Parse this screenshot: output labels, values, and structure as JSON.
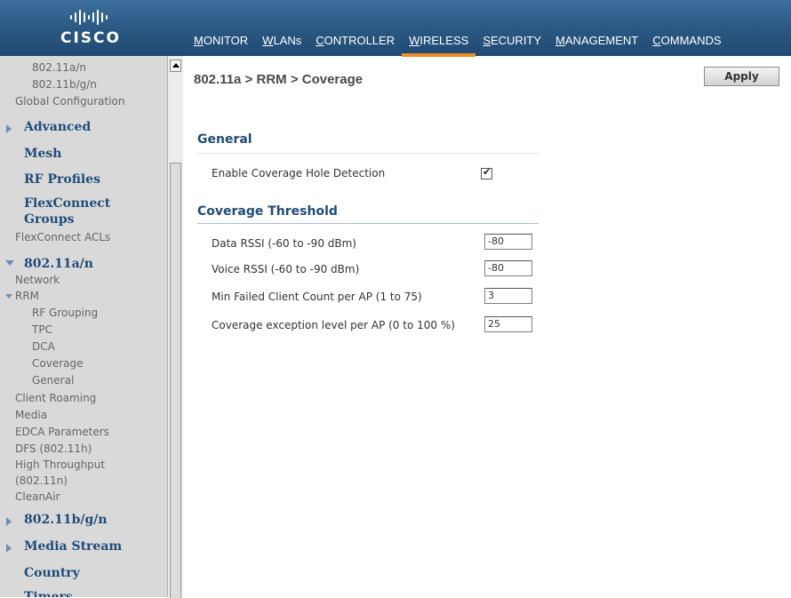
{
  "header": {
    "brand": "CISCO",
    "nav": [
      {
        "first": "M",
        "rest": "ONITOR"
      },
      {
        "first": "W",
        "rest": "LANs"
      },
      {
        "first": "C",
        "rest": "ONTROLLER"
      },
      {
        "first": "W",
        "rest": "IRELESS"
      },
      {
        "first": "S",
        "rest": "ECURITY"
      },
      {
        "first": "M",
        "rest": "ANAGEMENT"
      },
      {
        "first": "C",
        "rest": "OMMANDS"
      }
    ],
    "active_index": 3,
    "active_color": "#f28d26"
  },
  "sidebar": {
    "top": {
      "a": "802.11a/n",
      "bg": "802.11b/g/n",
      "global": "Global Configuration"
    },
    "advanced": "Advanced",
    "mesh": "Mesh",
    "rf_profiles": "RF Profiles",
    "flexconnect_groups_1": "FlexConnect",
    "flexconnect_groups_2": "Groups",
    "flexconnect_acls": "FlexConnect ACLs",
    "radio_a": "802.11a/n",
    "network": "Network",
    "rrm": "RRM",
    "rrm_items": [
      "RF Grouping",
      "TPC",
      "DCA",
      "Coverage",
      "General"
    ],
    "client_roaming": "Client Roaming",
    "media": "Media",
    "edca": "EDCA Parameters",
    "dfs": "DFS (802.11h)",
    "ht_1": "High Throughput",
    "ht_2": "(802.11n)",
    "cleanair": "CleanAir",
    "radio_bg": "802.11b/g/n",
    "media_stream": "Media Stream",
    "country": "Country",
    "timers": "Timers"
  },
  "main": {
    "title": "802.11a > RRM > Coverage",
    "apply_label": "Apply",
    "general": {
      "heading": "General",
      "enable_label": "Enable Coverage Hole Detection",
      "enable_checked": true
    },
    "threshold": {
      "heading": "Coverage Threshold",
      "fields": [
        {
          "label": "Data RSSI (-60 to -90 dBm)",
          "value": "-80"
        },
        {
          "label": "Voice RSSI (-60 to -90 dBm)",
          "value": "-80"
        },
        {
          "label": "Min Failed Client Count per AP (1 to 75)",
          "value": "3"
        },
        {
          "label": "Coverage exception level per AP (0 to 100 %)",
          "value": "25"
        }
      ]
    }
  }
}
